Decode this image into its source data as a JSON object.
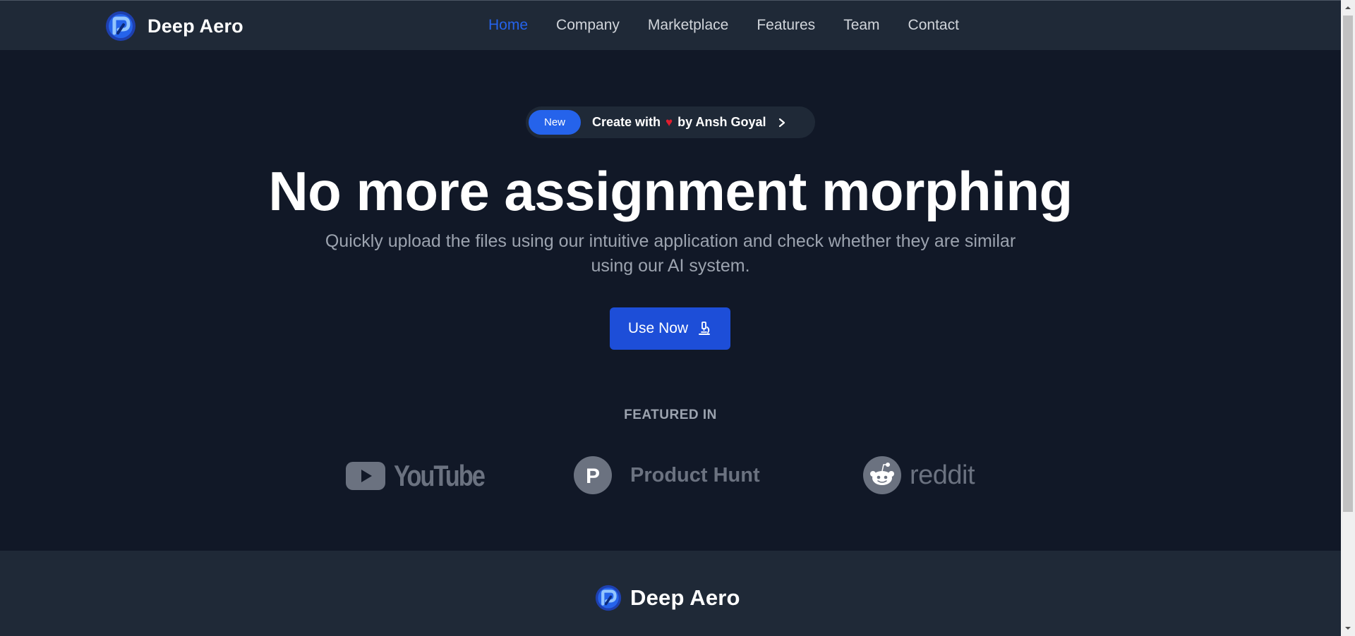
{
  "navbar": {
    "brand": "Deep Aero",
    "links": [
      {
        "label": "Home",
        "active": true
      },
      {
        "label": "Company"
      },
      {
        "label": "Marketplace"
      },
      {
        "label": "Features"
      },
      {
        "label": "Team"
      },
      {
        "label": "Contact"
      }
    ]
  },
  "hero": {
    "pill": {
      "badge": "New",
      "text_before": "Create with",
      "heart": "♥",
      "text_after": "by Ansh Goyal",
      "icon": "chevron-right-icon"
    },
    "headline": "No more assignment morphing",
    "subtext": "Quickly upload the files using our intuitive application and check whether they are similar using our AI system.",
    "cta": {
      "label": "Use Now",
      "icon": "microscope-icon"
    },
    "featured_label": "FEATURED IN",
    "featured": [
      {
        "name": "YouTube",
        "wordmark": "YouTube",
        "icon": "youtube-play-icon"
      },
      {
        "name": "Product Hunt",
        "wordmark": "Product Hunt",
        "icon": "product-hunt-icon",
        "letter": "P"
      },
      {
        "name": "Reddit",
        "wordmark": "reddit",
        "icon": "reddit-alien-icon"
      }
    ]
  },
  "footer": {
    "brand": "Deep Aero"
  },
  "colors": {
    "background": "#111827",
    "navbar": "#1f2937",
    "accent": "#2563eb",
    "cta": "#1d4ed8",
    "muted": "#9ca3af",
    "logo_gray": "#6b7280",
    "heart": "#e11d2e"
  }
}
